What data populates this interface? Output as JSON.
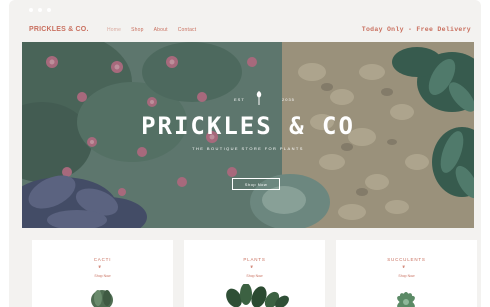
{
  "header": {
    "logo": "PRICKLES & CO.",
    "nav": [
      "Home",
      "Shop",
      "About",
      "Contact"
    ],
    "promo": "Today Only - Free Delivery"
  },
  "hero": {
    "est_left": "EST",
    "est_right": "2035",
    "title": "PRICKLES & CO",
    "subtitle": "THE BOUTIQUE STORE FOR PLANTS",
    "button": "Shop Now"
  },
  "cards": [
    {
      "name": "CACTI",
      "shop": "Shop Now"
    },
    {
      "name": "PLANTS",
      "shop": "Shop Now"
    },
    {
      "name": "SUCCULENTS",
      "shop": "Shop Now"
    }
  ],
  "colors": {
    "accent": "#c9705f",
    "background": "#f3f2f0"
  }
}
